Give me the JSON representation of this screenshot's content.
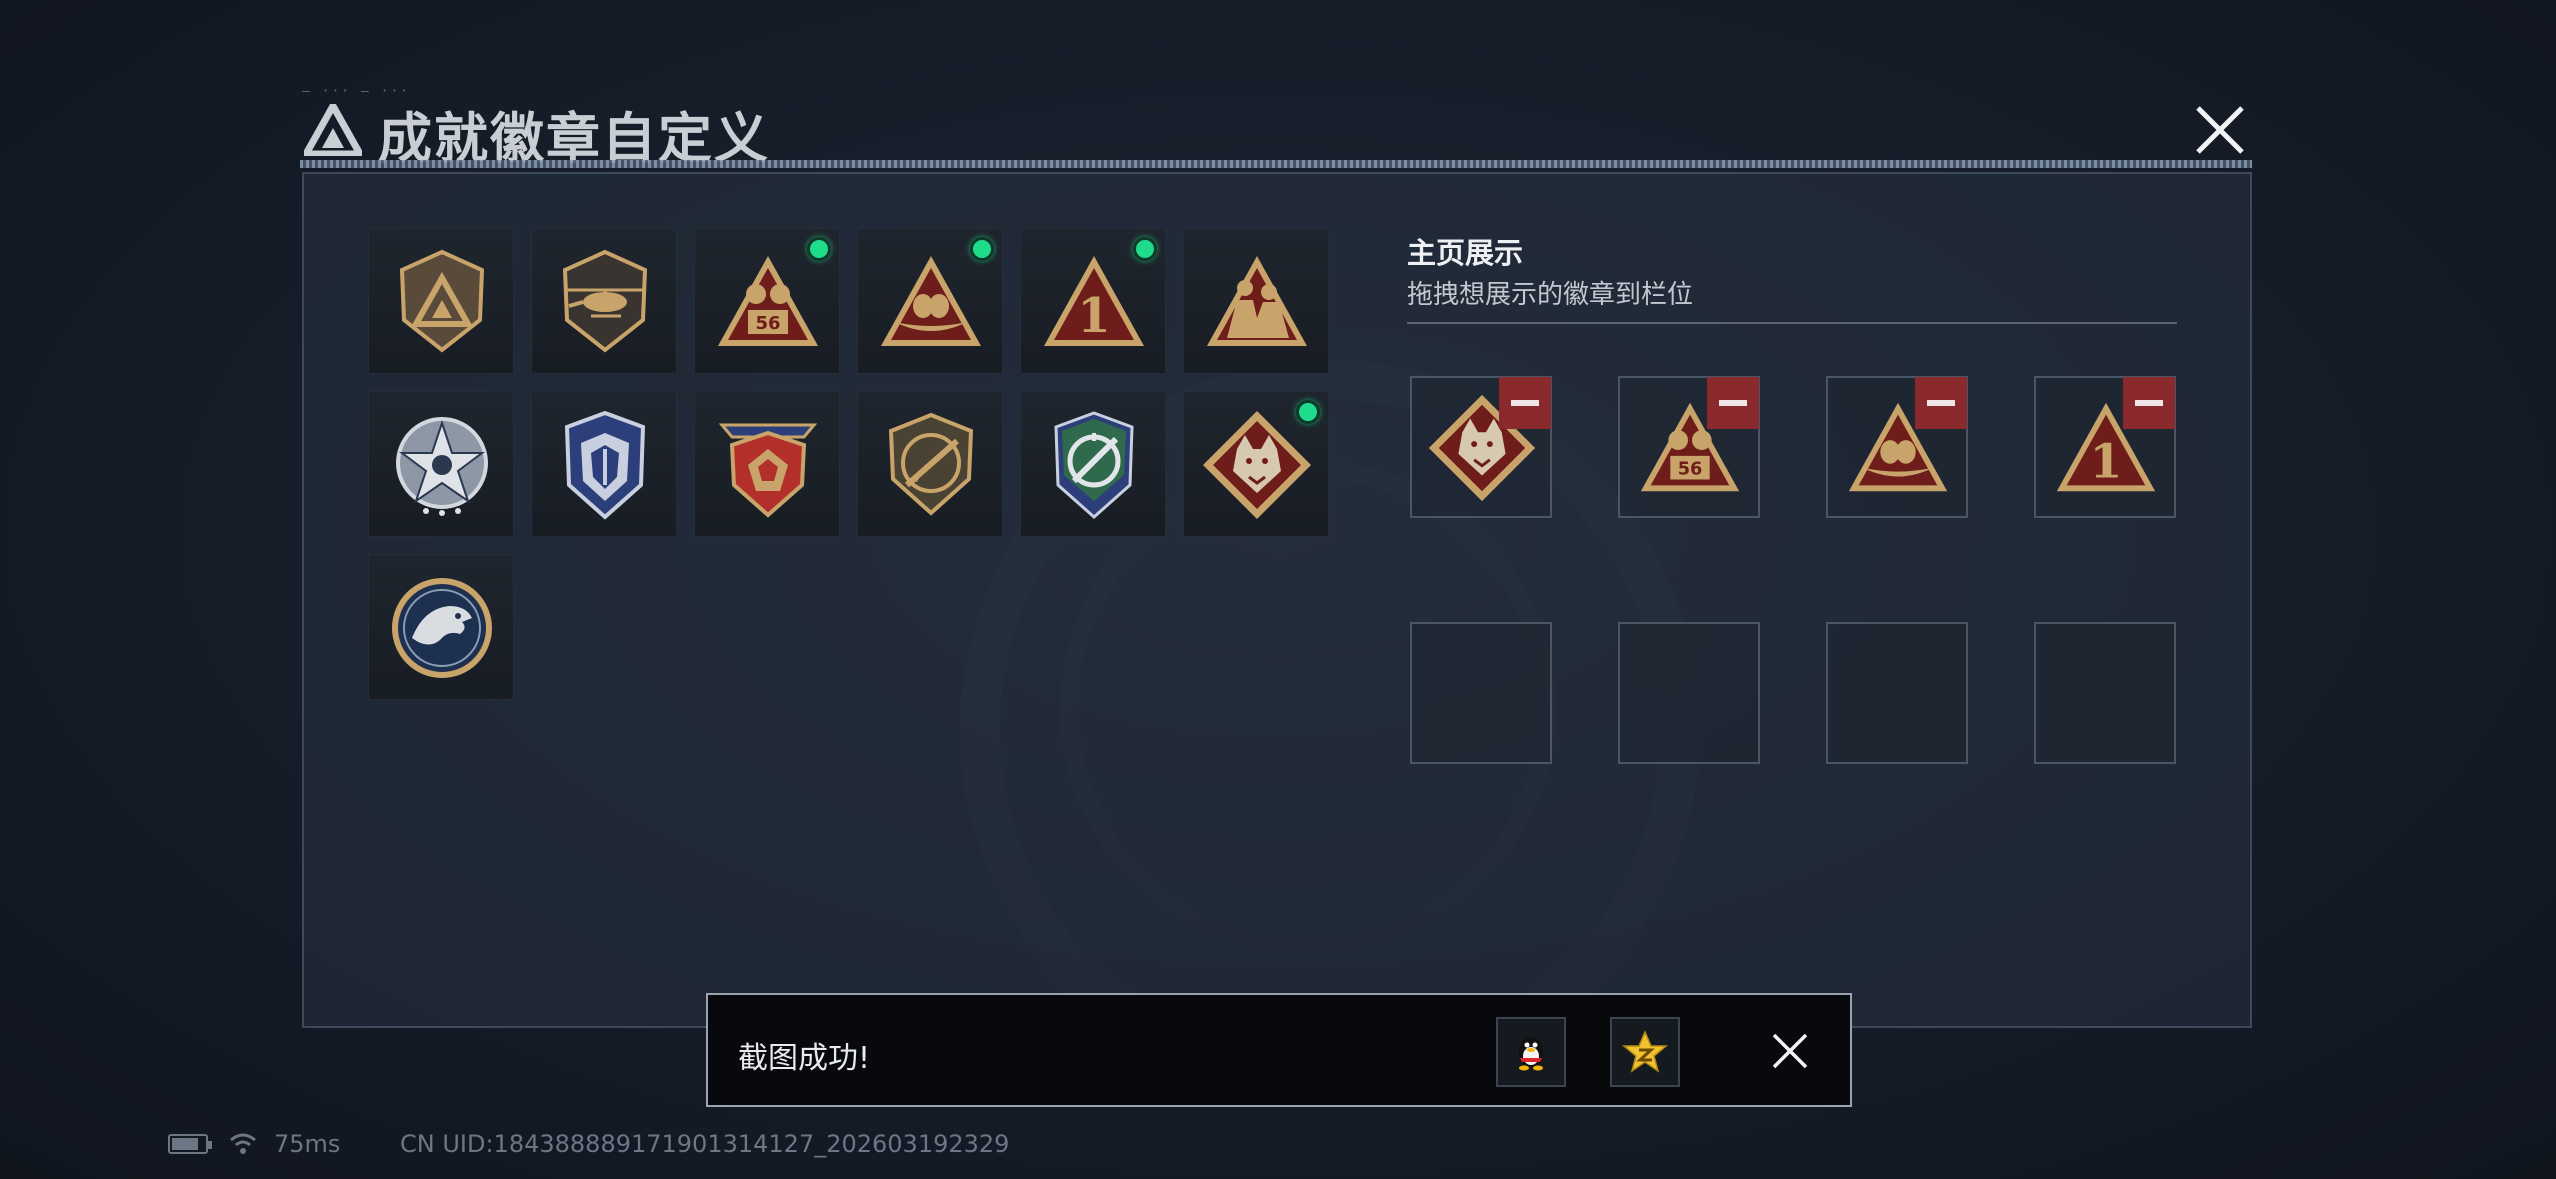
{
  "header": {
    "tag_text": "— ··· — ···",
    "title": "成就徽章自定义",
    "close_icon": "close-icon"
  },
  "badge_grid": {
    "badges": [
      {
        "icon": "triangle-shield-badge",
        "new": false
      },
      {
        "icon": "helicopter-shield-badge",
        "new": false
      },
      {
        "icon": "56-triangle-badge",
        "new": true
      },
      {
        "icon": "nest-triangle-badge",
        "new": true
      },
      {
        "icon": "number-1-triangle-badge",
        "new": true
      },
      {
        "icon": "soldiers-triangle-badge",
        "new": false
      },
      {
        "icon": "star-compass-badge",
        "new": false
      },
      {
        "icon": "blue-shield-badge",
        "new": false
      },
      {
        "icon": "red-crest-badge",
        "new": false
      },
      {
        "icon": "rifle-shield-badge",
        "new": false
      },
      {
        "icon": "green-crosshair-shield-badge",
        "new": false
      },
      {
        "icon": "wolf-diamond-badge",
        "new": true
      },
      {
        "icon": "eagle-round-badge",
        "new": false
      }
    ],
    "new_indicator_color": "#1fdc8b"
  },
  "showcase": {
    "title": "主页展示",
    "subtitle": "拖拽想展示的徽章到栏位",
    "slots": [
      {
        "icon": "wolf-diamond-badge",
        "filled": true
      },
      {
        "icon": "56-triangle-badge",
        "filled": true
      },
      {
        "icon": "nest-triangle-badge",
        "filled": true
      },
      {
        "icon": "number-1-triangle-badge",
        "filled": true
      },
      {
        "icon": "",
        "filled": false
      },
      {
        "icon": "",
        "filled": false
      },
      {
        "icon": "",
        "filled": false
      },
      {
        "icon": "",
        "filled": false
      }
    ],
    "remove_color": "#8a2a2c"
  },
  "toast": {
    "message": "截图成功!",
    "share_qq_icon": "qq-penguin-icon",
    "share_qzone_icon": "qzone-star-icon",
    "close_icon": "close-icon"
  },
  "status_bar": {
    "latency": "75ms",
    "uid": "CN UID:1843888891719013141​27_202603192329"
  },
  "colors": {
    "gold": "#c9a46a",
    "badge_red": "#7a1f1c",
    "accent_green": "#1fdc8b"
  }
}
